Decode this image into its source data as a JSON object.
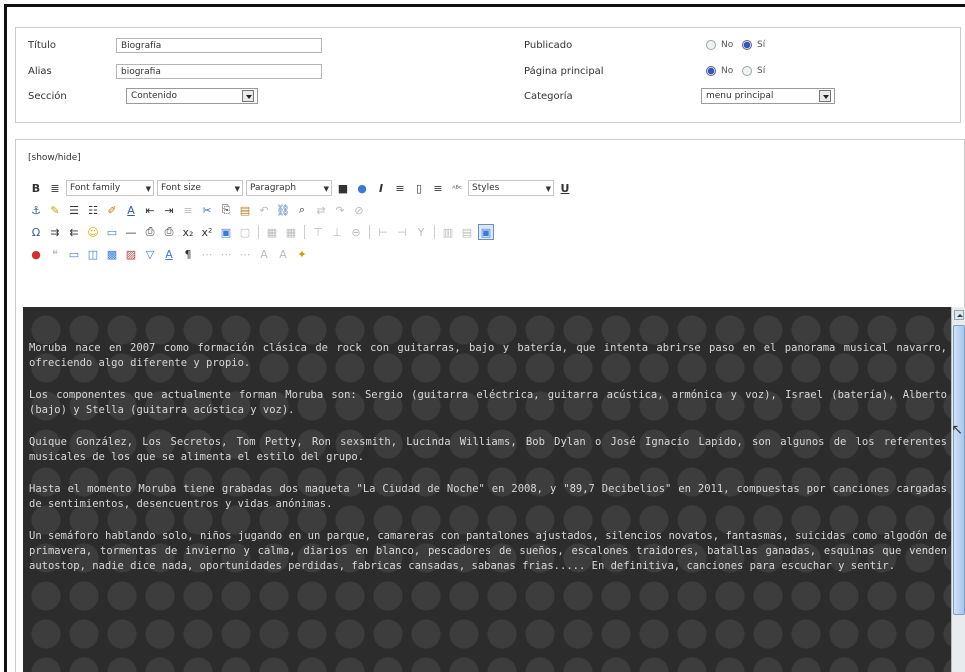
{
  "form": {
    "titulo_label": "Título",
    "titulo_value": "Biografía",
    "alias_label": "Alias",
    "alias_value": "biografia",
    "seccion_label": "Sección",
    "seccion_value": "Contenido",
    "publicado_label": "Publicado",
    "publicado_no": "No",
    "publicado_si": "Sí",
    "publicado_selected": "Sí",
    "pagina_label": "Página principal",
    "pagina_no": "No",
    "pagina_si": "Sí",
    "pagina_selected": "No",
    "categoria_label": "Categoría",
    "categoria_value": "menu principal"
  },
  "editor": {
    "showhide_label": "[show/hide]",
    "toolbar": {
      "font_family": "Font family",
      "font_size": "Font size",
      "format": "Paragraph",
      "styles": "Styles"
    },
    "paragraphs": [
      "Moruba nace en 2007 como formación clásica de rock con guitarras, bajo y batería, que intenta abrirse paso en el panorama musical navarro, ofreciendo algo diferente y propio.",
      "Los componentes que actualmente forman Moruba son: Sergio (guitarra eléctrica, guitarra acústica, armónica y voz), Israel (batería), Alberto (bajo) y Stella (guitarra acústica y voz).",
      "Quique González, Los Secretos, Tom Petty, Ron sexsmith, Lucinda Williams, Bob Dylan o José Ignacio Lapido, son algunos de los referentes musicales de los que se alimenta el estilo del grupo.",
      "Hasta el momento Moruba tiene grabadas dos maqueta \"La Ciudad de Noche\" en 2008, y \"89,7 Decibelios\" en 2011, compuestas por canciones cargadas de sentimientos, desencuentros y vidas anónimas.",
      "Un semáforo hablando solo, niños jugando en un parque, camareras con pantalones ajustados, silencios novatos, fantasmas, suicidas como algodón de primavera, tormentas de invierno y calma, diarios en blanco, pescadores de sueños, escalones traidores, batallas ganadas, esquinas que venden autostop, nadie dice nada, oportunidades perdidas, fabricas cansadas, sabanas frias..... En definitiva, canciones para escuchar y sentir."
    ]
  },
  "colors": {
    "editor_bg": "#2c2c2c",
    "editor_text": "#d8d8d8",
    "radio_selected": "#3355cc"
  }
}
